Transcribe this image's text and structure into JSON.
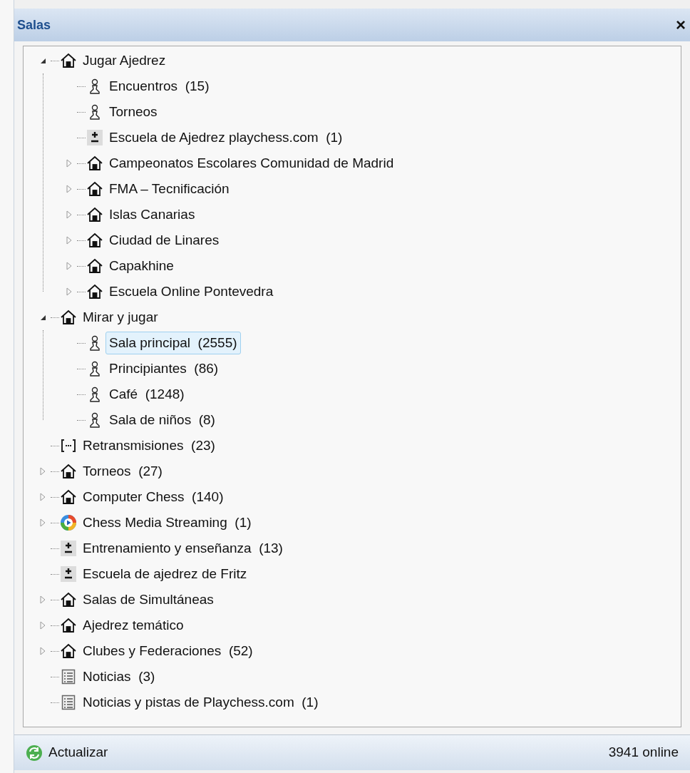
{
  "window": {
    "title": "Salas",
    "close": "×"
  },
  "tree": [
    {
      "kind": "house",
      "label": "Jugar Ajedrez",
      "expanded": true,
      "selected": false,
      "children": [
        {
          "kind": "pawn",
          "label": "Encuentros  (15)",
          "selected": false
        },
        {
          "kind": "pawn",
          "label": "Torneos",
          "selected": false
        },
        {
          "kind": "school",
          "label": "Escuela de Ajedrez playchess.com  (1)",
          "selected": false
        },
        {
          "kind": "house",
          "label": "Campeonatos Escolares Comunidad de Madrid",
          "expanded": false,
          "selected": false
        },
        {
          "kind": "house",
          "label": "FMA – Tecnificación",
          "expanded": false,
          "selected": false
        },
        {
          "kind": "house",
          "label": "Islas Canarias",
          "expanded": false,
          "selected": false
        },
        {
          "kind": "house",
          "label": "Ciudad de Linares",
          "expanded": false,
          "selected": false
        },
        {
          "kind": "house",
          "label": "Capakhine",
          "expanded": false,
          "selected": false
        },
        {
          "kind": "house",
          "label": "Escuela Online Pontevedra",
          "expanded": false,
          "selected": false
        }
      ]
    },
    {
      "kind": "house",
      "label": "Mirar y jugar",
      "expanded": true,
      "selected": false,
      "children": [
        {
          "kind": "pawn",
          "label": "Sala principal  (2555)",
          "selected": true
        },
        {
          "kind": "pawn",
          "label": "Principiantes  (86)",
          "selected": false
        },
        {
          "kind": "pawn",
          "label": "Café  (1248)",
          "selected": false
        },
        {
          "kind": "pawn",
          "label": "Sala de niños  (8)",
          "selected": false
        }
      ]
    },
    {
      "kind": "broadcast",
      "label": "Retransmisiones  (23)",
      "selected": false
    },
    {
      "kind": "house",
      "label": "Torneos  (27)",
      "expanded": false,
      "selected": false
    },
    {
      "kind": "house",
      "label": "Computer Chess  (140)",
      "expanded": false,
      "selected": false
    },
    {
      "kind": "media",
      "label": "Chess Media Streaming  (1)",
      "expanded": false,
      "selected": false
    },
    {
      "kind": "school",
      "label": "Entrenamiento y enseñanza  (13)",
      "selected": false
    },
    {
      "kind": "school",
      "label": "Escuela de ajedrez de Fritz",
      "selected": false
    },
    {
      "kind": "house",
      "label": "Salas de Simultáneas",
      "expanded": false,
      "selected": false
    },
    {
      "kind": "house",
      "label": "Ajedrez temático",
      "expanded": false,
      "selected": false
    },
    {
      "kind": "house",
      "label": "Clubes y Federaciones  (52)",
      "expanded": false,
      "selected": false
    },
    {
      "kind": "news",
      "label": "Noticias  (3)",
      "selected": false
    },
    {
      "kind": "news",
      "label": "Noticias y pistas de Playchess.com  (1)",
      "selected": false
    }
  ],
  "status_bar": {
    "button": "Actualizar",
    "online": "3941 online"
  }
}
